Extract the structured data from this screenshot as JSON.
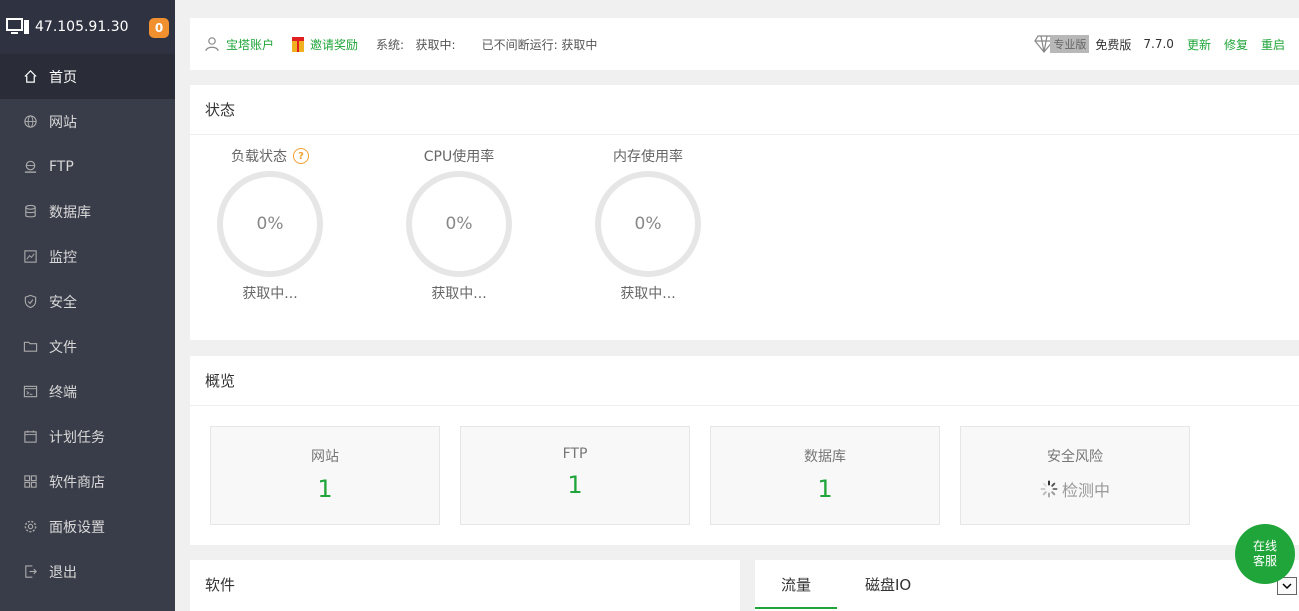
{
  "sidebar": {
    "ip": "47.105.91.30",
    "badge": "0",
    "items": [
      {
        "label": "首页",
        "icon": "home-icon"
      },
      {
        "label": "网站",
        "icon": "globe-icon"
      },
      {
        "label": "FTP",
        "icon": "ftp-icon"
      },
      {
        "label": "数据库",
        "icon": "database-icon"
      },
      {
        "label": "监控",
        "icon": "monitor-chart-icon"
      },
      {
        "label": "安全",
        "icon": "shield-icon"
      },
      {
        "label": "文件",
        "icon": "folder-icon"
      },
      {
        "label": "终端",
        "icon": "terminal-icon"
      },
      {
        "label": "计划任务",
        "icon": "calendar-icon"
      },
      {
        "label": "软件商店",
        "icon": "grid-icon"
      },
      {
        "label": "面板设置",
        "icon": "gear-icon"
      },
      {
        "label": "退出",
        "icon": "logout-icon"
      }
    ]
  },
  "topbar": {
    "account": "宝塔账户",
    "invite": "邀请奖励",
    "system_label": "系统:",
    "system_value": "获取中:",
    "uptime": "已不间断运行: 获取中",
    "pro_label": "专业版",
    "edition": "免费版",
    "version": "7.7.0",
    "update": "更新",
    "repair": "修复",
    "restart": "重启"
  },
  "status": {
    "title": "状态",
    "gauges": [
      {
        "label": "负载状态",
        "value": "0%",
        "sub": "获取中..."
      },
      {
        "label": "CPU使用率",
        "value": "0%",
        "sub": "获取中..."
      },
      {
        "label": "内存使用率",
        "value": "0%",
        "sub": "获取中..."
      }
    ]
  },
  "overview": {
    "title": "概览",
    "cards": [
      {
        "name": "网站",
        "value": "1"
      },
      {
        "name": "FTP",
        "value": "1"
      },
      {
        "name": "数据库",
        "value": "1"
      },
      {
        "name": "安全风险",
        "detecting": "检测中"
      }
    ]
  },
  "software": {
    "title": "软件"
  },
  "traffic": {
    "tabs": [
      "流量",
      "磁盘IO"
    ]
  },
  "kefu": {
    "line1": "在线",
    "line2": "客服"
  },
  "colors": {
    "accent": "#20a53a",
    "sidebar": "#393d49",
    "badge": "#f0902e"
  }
}
